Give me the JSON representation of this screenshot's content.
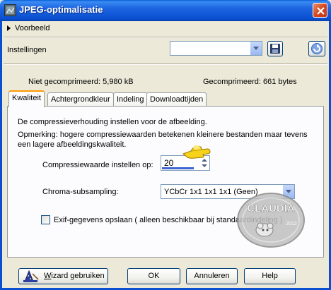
{
  "window": {
    "title": "JPEG-optimalisatie"
  },
  "preview": {
    "label": "Voorbeeld"
  },
  "settings": {
    "label": "Instellingen",
    "selected": ""
  },
  "sizes": {
    "uncompressed": "Niet gecomprimeerd:  5,980 kB",
    "compressed": "Gecomprimeerd: 661 bytes"
  },
  "tabs": [
    {
      "label": "Kwaliteit",
      "active": true
    },
    {
      "label": "Achtergrondkleur",
      "active": false
    },
    {
      "label": "Indeling",
      "active": false
    },
    {
      "label": "Downloadtijden",
      "active": false
    }
  ],
  "quality_tab": {
    "description": "De compressieverhouding instellen voor de afbeelding.",
    "remark": "Opmerking:  hogere compressiewaarden betekenen kleinere bestanden maar tevens een lagere afbeeldingskwaliteit.",
    "compression_label": "Compressiewaarde instellen op:",
    "compression_value": "20",
    "chroma_label": "Chroma-subsampling:",
    "chroma_value": "YCbCr  1x1  1x1  1x1  (Geen)",
    "exif_label": "Exif-gegevens opslaan ( alleen beschikbaar bij standaardindeling )",
    "exif_checked": false
  },
  "watermark": {
    "name": "CLAUDIA",
    "year": "2012"
  },
  "buttons": {
    "wizard_prefix": "W",
    "wizard_rest": "izard gebruiken",
    "ok": "OK",
    "cancel": "Annuleren",
    "help": "Help"
  },
  "colors": {
    "titlebar": "#0a4fd0",
    "face": "#ece9d8",
    "active_tab_accent": "#ff9a00"
  }
}
